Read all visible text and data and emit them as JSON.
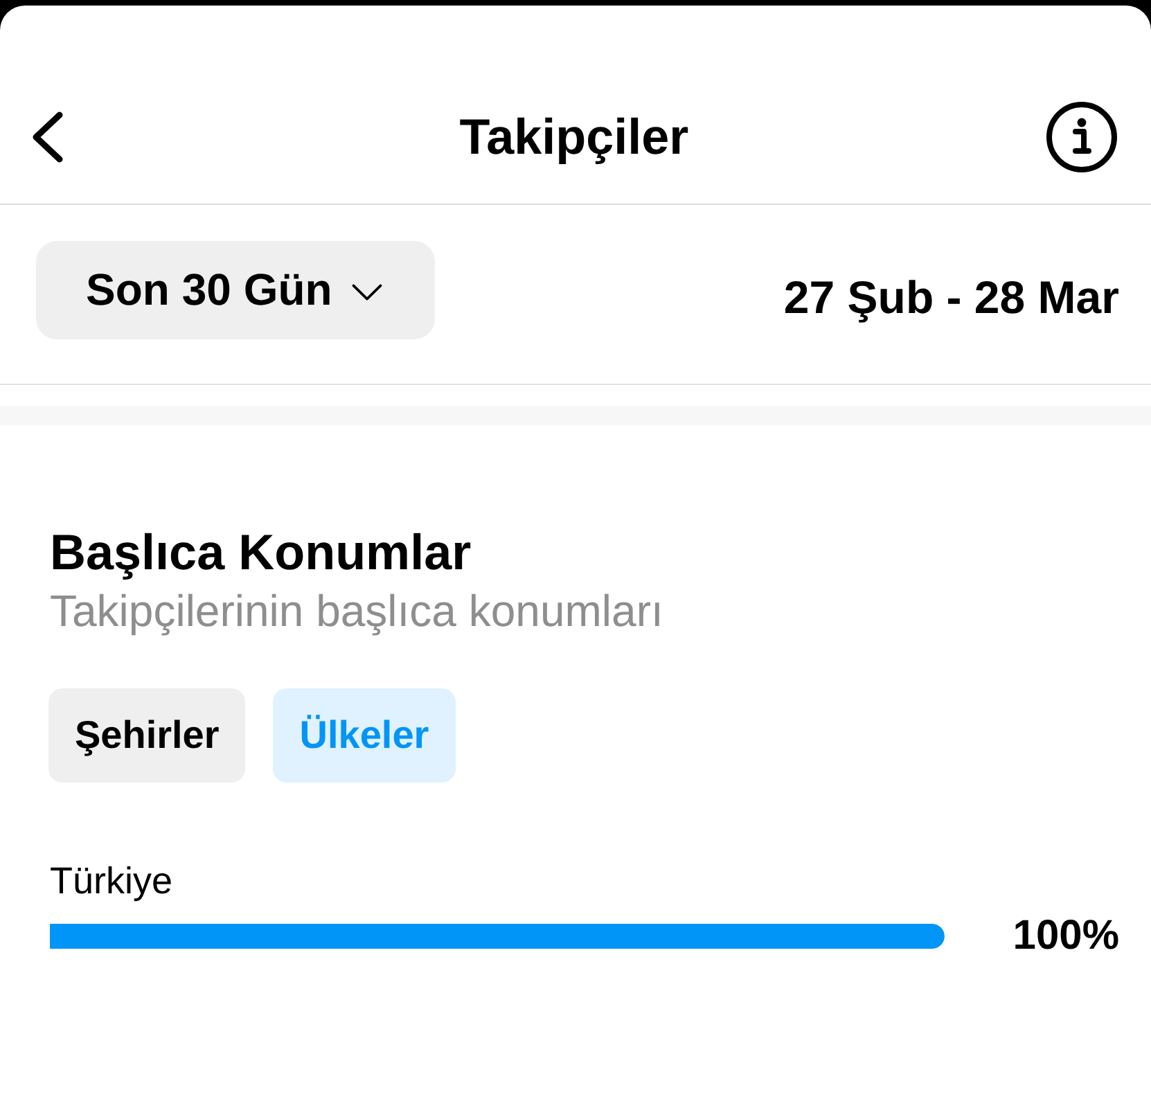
{
  "header": {
    "title": "Takipçiler"
  },
  "filter": {
    "period": "Son 30 Gün",
    "date_range": "27 Şub - 28 Mar"
  },
  "section": {
    "title": "Başlıca Konumlar",
    "subtitle": "Takipçilerinin başlıca konumları"
  },
  "tabs": [
    {
      "label": "Şehirler",
      "selected": false
    },
    {
      "label": "Ülkeler",
      "selected": true
    }
  ],
  "locations": [
    {
      "name": "Türkiye",
      "level": 1,
      "reading": "100%"
    }
  ]
}
